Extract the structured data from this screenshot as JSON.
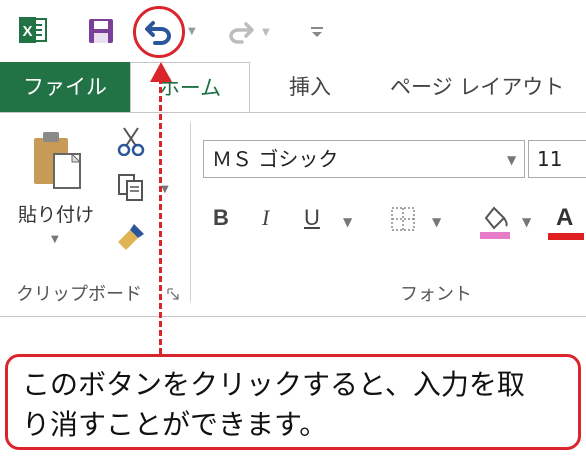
{
  "quick_access": {
    "app_icon": "excel-icon",
    "save_icon": "save-icon",
    "undo_icon": "undo-icon",
    "redo_icon": "redo-icon",
    "customize_icon": "customize-qat-icon"
  },
  "tabs": [
    {
      "label": "ファイル"
    },
    {
      "label": "ホーム"
    },
    {
      "label": "挿入"
    },
    {
      "label": "ページ レイアウト"
    }
  ],
  "clipboard": {
    "paste_label": "貼り付け",
    "group_label": "クリップボード"
  },
  "font": {
    "name": "ＭＳ ゴシック",
    "size": "11",
    "bold": "B",
    "italic": "I",
    "underline": "U",
    "color_letter": "A",
    "group_label": "フォント"
  },
  "callout": {
    "line1": "このボタンをクリックすると、入力を取",
    "line2": "り消すことができます。"
  },
  "colors": {
    "accent_red": "#d9252b",
    "excel_green": "#217346",
    "highlight_pink": "#e77bc8"
  }
}
